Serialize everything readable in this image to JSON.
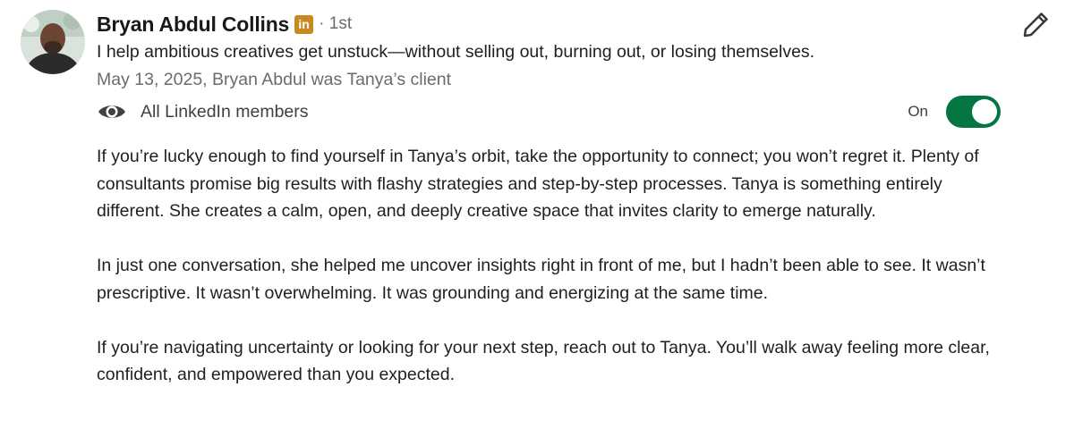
{
  "recommendation": {
    "author_name": "Bryan Abdul Collins",
    "linkedin_badge": "in",
    "connection_degree": "· 1st",
    "headline": "I help ambitious creatives get unstuck—without selling out, burning out, or losing themselves.",
    "meta": "May 13, 2025, Bryan Abdul was Tanya’s client",
    "visibility": {
      "icon": "eye-icon",
      "label": "All LinkedIn members"
    },
    "toggle": {
      "label": "On",
      "state": "on",
      "color": "#057642"
    },
    "edit_icon": "pencil-icon",
    "paragraphs": [
      "If you’re lucky enough to find yourself in Tanya’s orbit, take the opportunity to connect; you won’t regret it. Plenty of consultants promise big results with flashy strategies and step-by-step processes. Tanya is something entirely different. She creates a calm, open, and deeply creative space that invites clarity to emerge naturally.",
      "In just one conversation, she helped me uncover insights right in front of me, but I hadn’t been able to see. It wasn’t prescriptive. It wasn’t overwhelming. It was grounding and energizing at the same time.",
      "If you’re navigating uncertainty or looking for your next step, reach out to Tanya. You’ll walk away feeling more clear, confident, and empowered than you expected."
    ]
  }
}
